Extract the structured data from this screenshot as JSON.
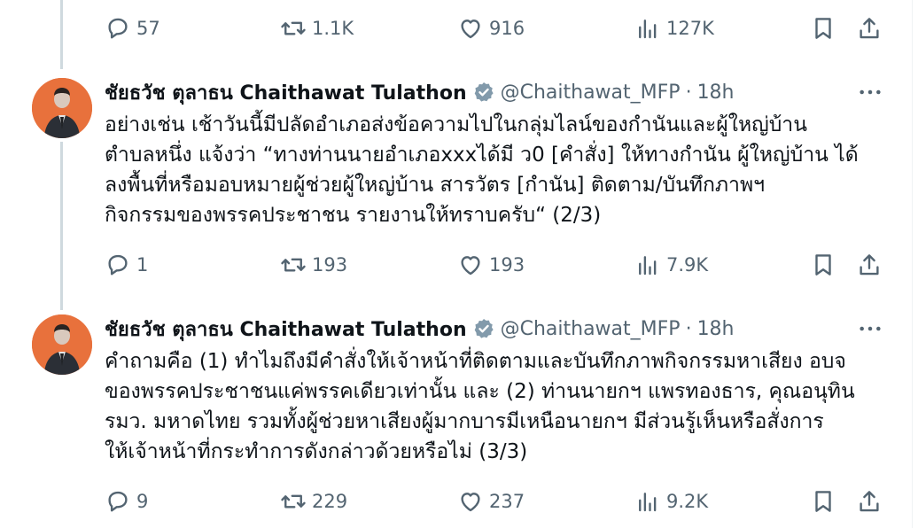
{
  "prev_tweet": {
    "actions": {
      "replies": "57",
      "retweets": "1.1K",
      "likes": "916",
      "views": "127K"
    }
  },
  "tweets": [
    {
      "author": {
        "name": "ชัยธวัช ตุลาธน Chaithawat Tulathon",
        "handle": "@Chaithawat_MFP",
        "separator": "·",
        "time": "18h"
      },
      "body_lines": [
        "อย่างเช่น เช้าวันนี้มีปลัดอำเภอส่งข้อความไปในกลุ่มไลน์ของกำนันและผู้ใหญ่บ้าน",
        "ตำบลหนึ่ง แจ้งว่า “ทางท่านนายอำเภอxxxได้มี ว0 [คำสั่ง] ให้ทางกำนัน ผู้ใหญ่บ้าน ได้",
        "ลงพื้นที่หรือมอบหมายผู้ช่วยผู้ใหญ่บ้าน สารวัตร [กำนัน] ติดตาม/บันทึกภาพฯ",
        "กิจกรรมของพรรคประชาชน รายงานให้ทราบครับ“ (2/3)"
      ],
      "actions": {
        "replies": "1",
        "retweets": "193",
        "likes": "193",
        "views": "7.9K"
      }
    },
    {
      "author": {
        "name": "ชัยธวัช ตุลาธน Chaithawat Tulathon",
        "handle": "@Chaithawat_MFP",
        "separator": "·",
        "time": "18h"
      },
      "body_lines": [
        "คำถามคือ (1) ทำไมถึงมีคำสั่งให้เจ้าหน้าที่ติดตามและบันทึกภาพกิจกรรมหาเสียง อบจ",
        "ของพรรคประชาชนแค่พรรคเดียวเท่านั้น และ (2) ท่านนายกฯ แพรทองธาร, คุณอนุทิน",
        "รมว. มหาดไทย รวมทั้งผู้ช่วยหาเสียงผู้มากบารมีเหนือนายกฯ มีส่วนรู้เห็นหรือสั่งการ",
        "ให้เจ้าหน้าที่กระทำการดังกล่าวด้วยหรือไม่ (3/3)"
      ],
      "actions": {
        "replies": "9",
        "retweets": "229",
        "likes": "237",
        "views": "9.2K"
      }
    }
  ],
  "icons": [
    "reply-icon",
    "retweet-icon",
    "like-icon",
    "views-icon",
    "bookmark-icon",
    "share-icon",
    "more-icon",
    "verified-badge-icon"
  ],
  "colors": {
    "text": "#0f1419",
    "secondary": "#536471",
    "thread_line": "#cfd9de",
    "avatar_bg": "#e8713c",
    "verified": "#829aab"
  }
}
